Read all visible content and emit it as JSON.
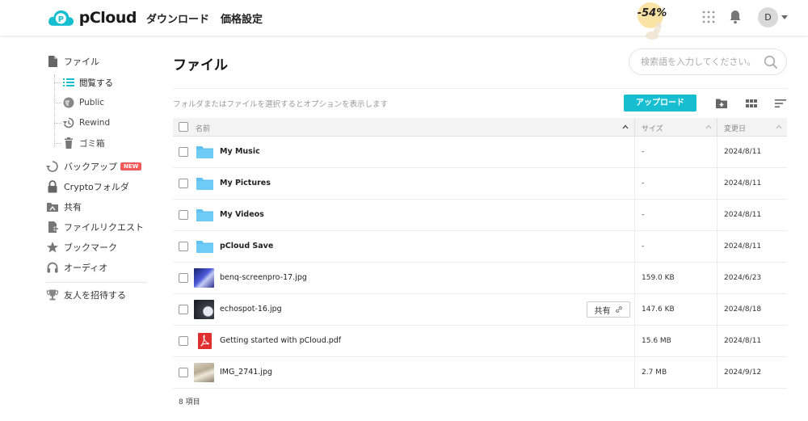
{
  "header": {
    "logo_text": "pCloud",
    "nav": [
      "ダウンロード",
      "価格設定"
    ],
    "promo_text": "-54%",
    "avatar_initial": "D"
  },
  "sidebar": {
    "files": "ファイル",
    "sub": [
      "閲覧する",
      "Public",
      "Rewind",
      "ゴミ箱"
    ],
    "backup": "バックアップ",
    "backup_badge": "NEW",
    "crypto": "Cryptoフォルダ",
    "shared": "共有",
    "file_request": "ファイルリクエスト",
    "bookmarks": "ブックマーク",
    "audio": "オーディオ",
    "invite": "友人を招待する"
  },
  "main": {
    "title": "ファイル",
    "search_placeholder": "検索語を入力してください。",
    "hint": "フォルダまたはファイルを選択するとオプションを表示します",
    "upload": "アップロード",
    "columns": {
      "name": "名前",
      "size": "サイズ",
      "modified": "変更日"
    },
    "rows": [
      {
        "name": "My Music",
        "size": "-",
        "date": "2024/8/11",
        "type": "folder"
      },
      {
        "name": "My Pictures",
        "size": "-",
        "date": "2024/8/11",
        "type": "folder"
      },
      {
        "name": "My Videos",
        "size": "-",
        "date": "2024/8/11",
        "type": "folder"
      },
      {
        "name": "pCloud Save",
        "size": "-",
        "date": "2024/8/11",
        "type": "folder"
      },
      {
        "name": "benq-screenpro-17.jpg",
        "size": "159.0 KB",
        "date": "2024/6/23",
        "type": "image"
      },
      {
        "name": "echospot-16.jpg",
        "size": "147.6 KB",
        "date": "2024/8/18",
        "type": "image",
        "share": "共有"
      },
      {
        "name": "Getting started with pCloud.pdf",
        "size": "15.6 MB",
        "date": "2024/8/11",
        "type": "pdf"
      },
      {
        "name": "IMG_2741.jpg",
        "size": "2.7 MB",
        "date": "2024/9/12",
        "type": "image"
      }
    ],
    "item_count": "8 項目"
  },
  "colors": {
    "accent": "#17bed0",
    "folder": "#5fc2f1",
    "pdf": "#e02f2f",
    "new_badge": "#f35b5b"
  }
}
